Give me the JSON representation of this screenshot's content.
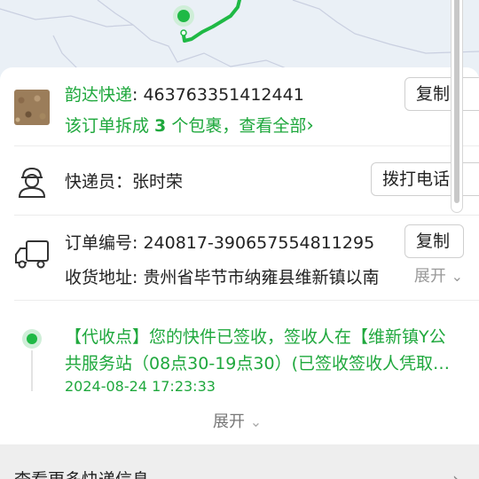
{
  "map": {
    "route_color": "#1fb945"
  },
  "package": {
    "courier": "韵达快递",
    "tracking_number": ": 463763351412441",
    "copy_label": "复制",
    "split_prefix": "该订单拆成 ",
    "split_count": "3",
    "split_suffix": " 个包裹，查看全部",
    "split_arrow": "›"
  },
  "deliverer": {
    "text": "快递员：张时荣",
    "call_label": "拨打电话"
  },
  "order": {
    "number_text": "订单编号: 240817-390657554811295",
    "copy_label": "复制",
    "address_text": "收货地址: 贵州省毕节市纳雍县维新镇以南",
    "expand_label": "展开",
    "expand_icon": "⌄"
  },
  "tracking_event": {
    "text": "【代收点】您的快件已签收，签收人在【维新镇Y公共服务站（08点30-19点30）(已签收签收人凭取货码签收)】",
    "time": "2024-08-24 17:23:33",
    "expand_label": "展开",
    "expand_icon": "⌄"
  },
  "more_info": {
    "label": "查看更多快递信息",
    "arrow": "›"
  },
  "colors": {
    "accent": "#1fa83d",
    "dot": "#1fb945"
  }
}
